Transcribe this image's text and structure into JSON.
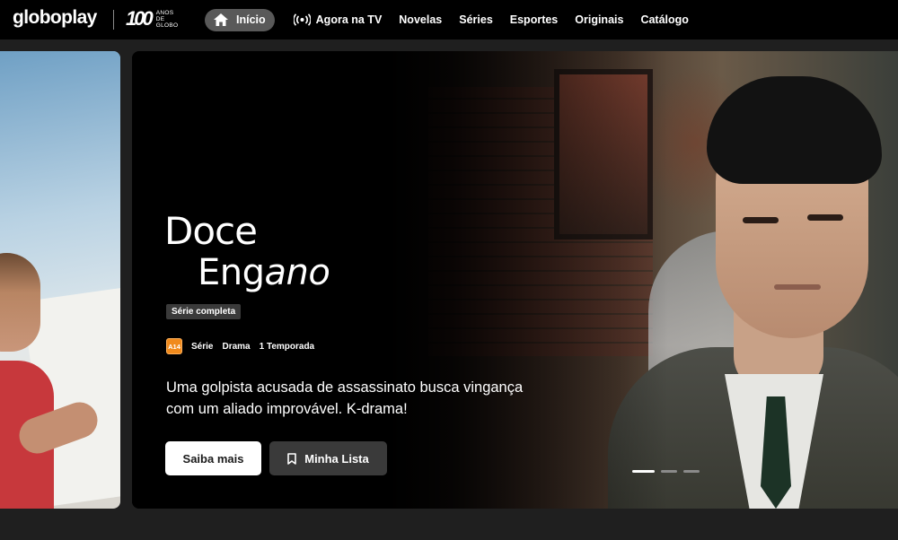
{
  "brand": {
    "logo": "globoplay",
    "anniversary_number": "100",
    "anniversary_text": [
      "ANOS",
      "DE",
      "GLOBO"
    ]
  },
  "nav": {
    "items": [
      {
        "label": "Início",
        "icon": "home-icon",
        "active": true
      },
      {
        "label": "Agora na TV",
        "icon": "live-broadcast-icon"
      },
      {
        "label": "Novelas"
      },
      {
        "label": "Séries"
      },
      {
        "label": "Esportes"
      },
      {
        "label": "Originais"
      },
      {
        "label": "Catálogo"
      }
    ]
  },
  "hero": {
    "title_line1": "Doce",
    "title_line2_prefix": "Eng",
    "title_line2_italic": "ano",
    "badge": "Série completa",
    "rating": "A14",
    "rating_color": "#f08a1c",
    "meta": [
      "Série",
      "Drama",
      "1 Temporada"
    ],
    "description": "Uma golpista acusada de assassinato busca vingança com um aliado improvável. K-drama!",
    "primary_button": "Saiba mais",
    "secondary_button": "Minha Lista",
    "carousel": {
      "total": 3,
      "active": 1
    }
  }
}
